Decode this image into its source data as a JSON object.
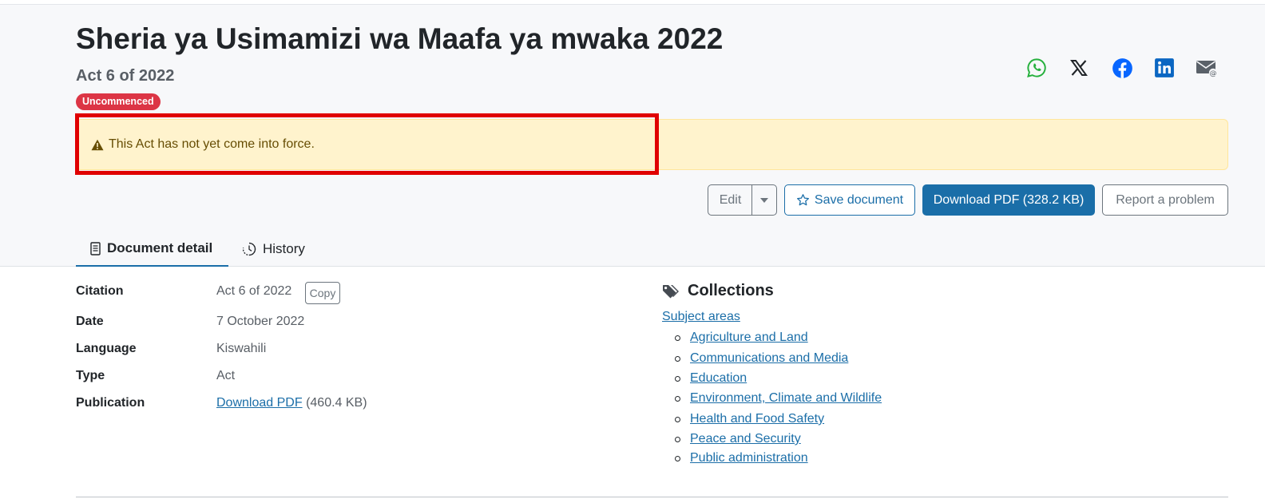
{
  "document": {
    "title": "Sheria ya Usimamizi wa Maafa ya mwaka 2022",
    "subtitle": "Act 6 of 2022",
    "status_badge": "Uncommenced"
  },
  "share": [
    "whatsapp-icon",
    "x-icon",
    "facebook-icon",
    "linkedin-icon",
    "email-icon"
  ],
  "alert": {
    "text": "This Act has not yet come into force."
  },
  "actions": {
    "edit_label": "Edit",
    "save_label": "Save document",
    "download_label": "Download PDF (328.2 KB)",
    "report_label": "Report a problem"
  },
  "tabs": [
    {
      "label": "Document detail"
    },
    {
      "label": "History"
    }
  ],
  "details": {
    "citation_label": "Citation",
    "citation_value": "Act 6 of 2022",
    "copy_label": "Copy",
    "date_label": "Date",
    "date_value": "7 October 2022",
    "language_label": "Language",
    "language_value": "Kiswahili",
    "type_label": "Type",
    "type_value": "Act",
    "publication_label": "Publication",
    "publication_link": "Download PDF",
    "publication_size": "(460.4 KB)"
  },
  "collections": {
    "heading": "Collections",
    "subject_areas_label": "Subject areas",
    "items": [
      "Agriculture and Land",
      "Communications and Media",
      "Education",
      "Environment, Climate and Wildlife",
      "Health and Food Safety",
      "Peace and Security",
      "Public administration"
    ]
  },
  "colors": {
    "primary": "#1a6ea8",
    "danger": "#dc3545",
    "alert_bg": "#fff3cd",
    "highlight": "#e00000"
  }
}
